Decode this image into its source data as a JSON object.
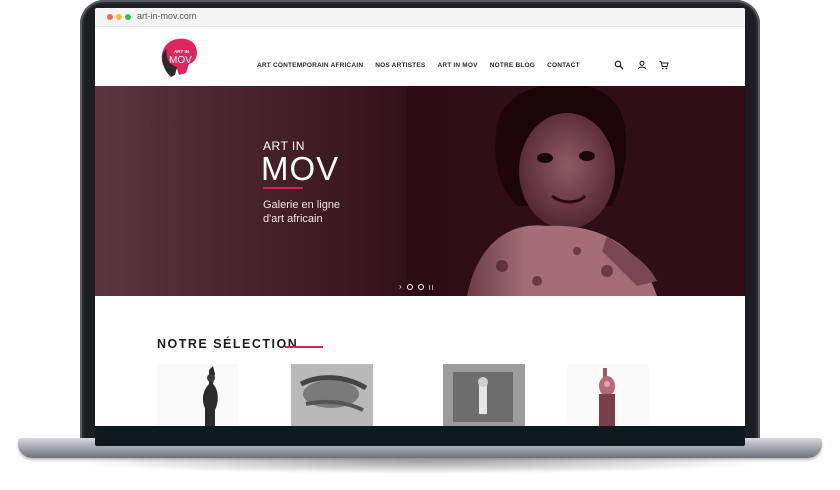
{
  "browser": {
    "url": "art-in-mov.com"
  },
  "logo": {
    "small_text": "ART IN",
    "big_text": "MOV"
  },
  "nav": {
    "items": [
      {
        "label": "ART CONTEMPORAIN AFRICAIN"
      },
      {
        "label": "NOS ARTISTES"
      },
      {
        "label": "ART IN MOV"
      },
      {
        "label": "NOTRE BLOG"
      },
      {
        "label": "CONTACT"
      }
    ]
  },
  "header_icons": [
    "search-icon",
    "user-icon",
    "cart-icon"
  ],
  "hero": {
    "title_top": "ART IN",
    "title_big": "MOV",
    "subtitle_line1": "Galerie en ligne",
    "subtitle_line2": "d'art africain",
    "controls": {
      "next": "›"
    }
  },
  "selection": {
    "title": "NOTRE SÉLECTION"
  },
  "colors": {
    "accent": "#d62454",
    "hero_dark": "#2d0c15",
    "footer": "#0f1a1f"
  }
}
